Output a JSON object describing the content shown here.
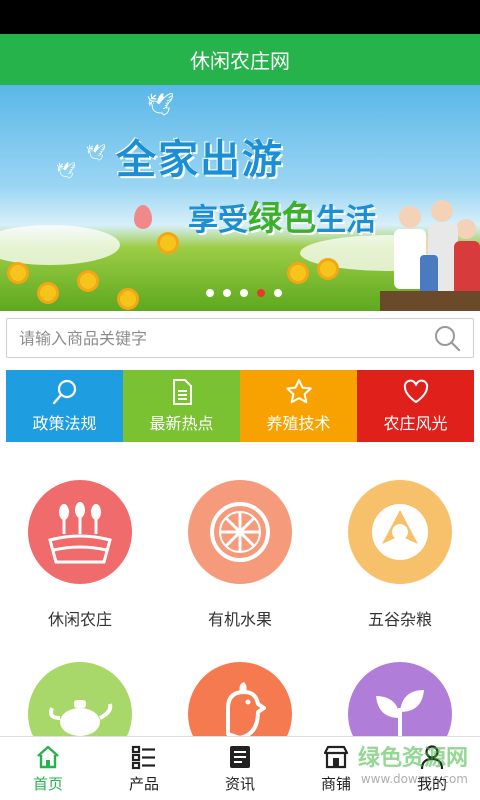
{
  "app": {
    "title": "休闲农庄网"
  },
  "banner": {
    "headline": "全家出游",
    "subline_prefix": "享受",
    "subline_green": "绿色",
    "subline_suffix": "生活",
    "dots": [
      false,
      false,
      false,
      true,
      false
    ]
  },
  "search": {
    "placeholder": "请输入商品关键字"
  },
  "categories": [
    {
      "label": "政策法规",
      "color": "#1e9ee0",
      "icon": "search-icon"
    },
    {
      "label": "最新热点",
      "color": "#7ac231",
      "icon": "document-icon"
    },
    {
      "label": "养殖技术",
      "color": "#f7a200",
      "icon": "star-icon"
    },
    {
      "label": "农庄风光",
      "color": "#e0201b",
      "icon": "heart-icon"
    }
  ],
  "grid": [
    {
      "label": "休闲农庄",
      "color": "#f06b6b",
      "icon": "farm-icon"
    },
    {
      "label": "有机水果",
      "color": "#f59a7a",
      "icon": "orange-slice-icon"
    },
    {
      "label": "五谷杂粮",
      "color": "#f7c06a",
      "icon": "grain-icon"
    },
    {
      "label": "",
      "color": "#a8d86a",
      "icon": "teapot-icon"
    },
    {
      "label": "",
      "color": "#f67a4f",
      "icon": "chicken-icon"
    },
    {
      "label": "",
      "color": "#b07ed8",
      "icon": "leaf-icon"
    }
  ],
  "tabs": [
    {
      "label": "首页",
      "icon": "home-icon",
      "active": true
    },
    {
      "label": "产品",
      "icon": "list-icon",
      "active": false
    },
    {
      "label": "资讯",
      "icon": "news-icon",
      "active": false
    },
    {
      "label": "商铺",
      "icon": "shop-icon",
      "active": false
    },
    {
      "label": "我的",
      "icon": "user-icon",
      "active": false
    }
  ],
  "watermark": {
    "text": "绿色资源网",
    "sub": "www.downcc.com"
  },
  "colors": {
    "primary": "#26b34b",
    "status_bar": "#000000"
  }
}
